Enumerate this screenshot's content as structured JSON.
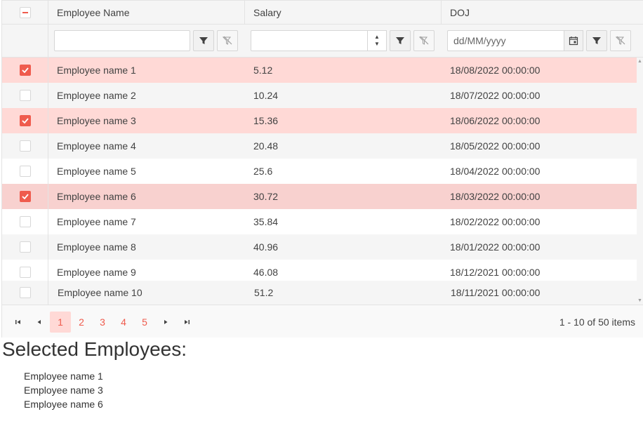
{
  "grid": {
    "columns": [
      "Employee Name",
      "Salary",
      "DOJ"
    ],
    "filters": {
      "name_value": "",
      "salary_value": "",
      "doj_placeholder": "dd/MM/yyyy"
    },
    "rows": [
      {
        "name": "Employee name 1",
        "salary": "5.12",
        "doj": "18/08/2022 00:00:00",
        "checked": true
      },
      {
        "name": "Employee name 2",
        "salary": "10.24",
        "doj": "18/07/2022 00:00:00",
        "checked": false
      },
      {
        "name": "Employee name 3",
        "salary": "15.36",
        "doj": "18/06/2022 00:00:00",
        "checked": true
      },
      {
        "name": "Employee name 4",
        "salary": "20.48",
        "doj": "18/05/2022 00:00:00",
        "checked": false
      },
      {
        "name": "Employee name 5",
        "salary": "25.6",
        "doj": "18/04/2022 00:00:00",
        "checked": false
      },
      {
        "name": "Employee name 6",
        "salary": "30.72",
        "doj": "18/03/2022 00:00:00",
        "checked": true
      },
      {
        "name": "Employee name 7",
        "salary": "35.84",
        "doj": "18/02/2022 00:00:00",
        "checked": false
      },
      {
        "name": "Employee name 8",
        "salary": "40.96",
        "doj": "18/01/2022 00:00:00",
        "checked": false
      },
      {
        "name": "Employee name 9",
        "salary": "46.08",
        "doj": "18/12/2021 00:00:00",
        "checked": false
      },
      {
        "name": "Employee name 10",
        "salary": "51.2",
        "doj": "18/11/2021 00:00:00",
        "checked": false
      }
    ],
    "icons": {
      "filter": "filter-icon",
      "clear_filter": "clear-filter-icon",
      "calendar": "calendar-icon",
      "spinner_up": "spinner-up-icon",
      "spinner_down": "spinner-down-icon"
    }
  },
  "pager": {
    "pages": [
      "1",
      "2",
      "3",
      "4",
      "5"
    ],
    "current_page": "1",
    "info": "1 - 10 of 50 items"
  },
  "selected": {
    "title": "Selected Employees:",
    "items": [
      "Employee name 1",
      "Employee name 3",
      "Employee name 6"
    ]
  },
  "colors": {
    "accent": "#ef5b4d",
    "selected_row": "#ffd9d6",
    "header_bg": "#f5f5f5"
  }
}
